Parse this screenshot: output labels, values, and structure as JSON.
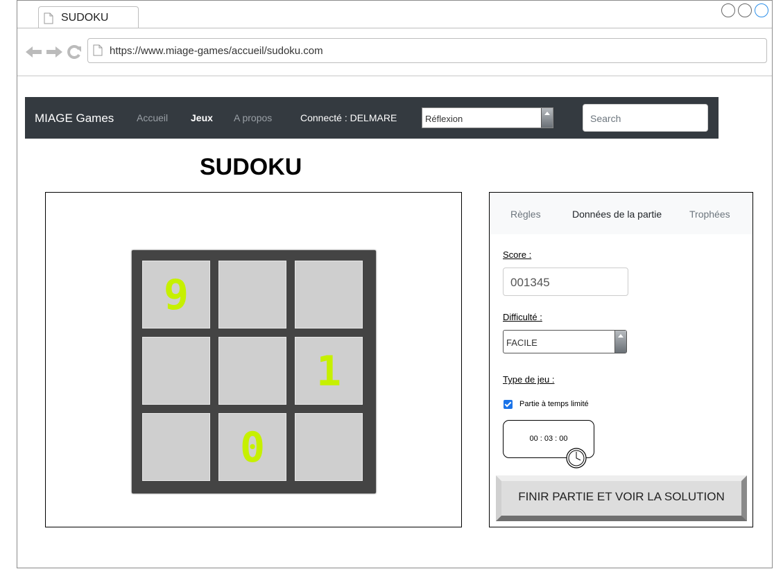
{
  "browser": {
    "tab_title": "SUDOKU",
    "url": "https://www.miage-games/accueil/sudoku.com"
  },
  "navbar": {
    "brand": "MIAGE Games",
    "links": [
      "Accueil",
      "Jeux",
      "A propos"
    ],
    "user_status": "Connecté : DELMARE",
    "category_select": "Réflexion",
    "search_placeholder": "Search"
  },
  "page": {
    "title": "SUDOKU"
  },
  "board": {
    "cells": [
      "9",
      "",
      "",
      "",
      "",
      "1",
      "",
      "0",
      ""
    ],
    "digit_color": "#c6f000",
    "cell_color": "#cfcfcf",
    "grid_color": "#444444"
  },
  "panel": {
    "tabs": [
      "Règles",
      "Données de la partie",
      "Trophées"
    ],
    "active_tab": "Données de la partie",
    "score_label": "Score :",
    "score_value": "001345",
    "difficulty_label": "Difficulté :",
    "difficulty_value": "FACILE",
    "game_type_label": "Type de jeu :",
    "timed_label": "Partie à temps limité",
    "timed_checked": true,
    "timer_value": "00 : 03 : 00",
    "finish_button": "FINIR PARTIE ET VOIR LA SOLUTION"
  },
  "colors": {
    "navbar_bg": "#343a40",
    "checkbox": "#1a73e8"
  }
}
